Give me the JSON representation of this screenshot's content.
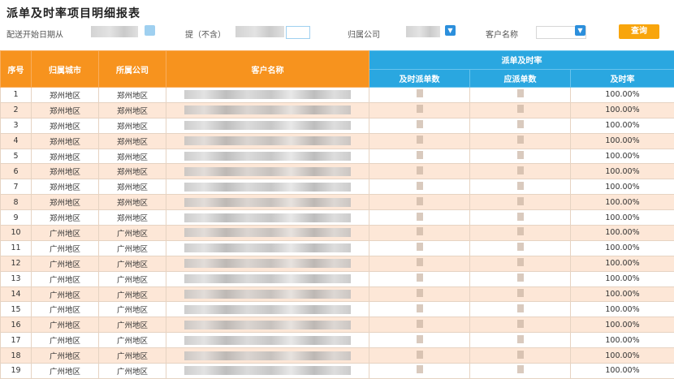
{
  "page": {
    "title": "派单及时率项目明细报表"
  },
  "filters": {
    "start_date_label": "配送开始日期从",
    "status_label": "提（不含）",
    "company_label": "归属公司",
    "customer_label": "客户名称",
    "dropdown_icon": "chevron-down-icon",
    "query_label": "查询"
  },
  "table": {
    "headers": {
      "seq": "序号",
      "region": "归属城市",
      "company": "所属公司",
      "customer": "客户名称",
      "group": "派单及时率",
      "col1": "及时派单数",
      "col2": "应派单数",
      "col3": "及时率"
    },
    "rows": [
      {
        "seq": "1",
        "region": "郑州地区",
        "company": "郑州地区",
        "rate": "100.00%"
      },
      {
        "seq": "2",
        "region": "郑州地区",
        "company": "郑州地区",
        "rate": "100.00%"
      },
      {
        "seq": "3",
        "region": "郑州地区",
        "company": "郑州地区",
        "rate": "100.00%"
      },
      {
        "seq": "4",
        "region": "郑州地区",
        "company": "郑州地区",
        "rate": "100.00%"
      },
      {
        "seq": "5",
        "region": "郑州地区",
        "company": "郑州地区",
        "rate": "100.00%"
      },
      {
        "seq": "6",
        "region": "郑州地区",
        "company": "郑州地区",
        "rate": "100.00%"
      },
      {
        "seq": "7",
        "region": "郑州地区",
        "company": "郑州地区",
        "rate": "100.00%"
      },
      {
        "seq": "8",
        "region": "郑州地区",
        "company": "郑州地区",
        "rate": "100.00%"
      },
      {
        "seq": "9",
        "region": "郑州地区",
        "company": "郑州地区",
        "rate": "100.00%"
      },
      {
        "seq": "10",
        "region": "广州地区",
        "company": "广州地区",
        "rate": "100.00%"
      },
      {
        "seq": "11",
        "region": "广州地区",
        "company": "广州地区",
        "rate": "100.00%"
      },
      {
        "seq": "12",
        "region": "广州地区",
        "company": "广州地区",
        "rate": "100.00%"
      },
      {
        "seq": "13",
        "region": "广州地区",
        "company": "广州地区",
        "rate": "100.00%"
      },
      {
        "seq": "14",
        "region": "广州地区",
        "company": "广州地区",
        "rate": "100.00%"
      },
      {
        "seq": "15",
        "region": "广州地区",
        "company": "广州地区",
        "rate": "100.00%"
      },
      {
        "seq": "16",
        "region": "广州地区",
        "company": "广州地区",
        "rate": "100.00%"
      },
      {
        "seq": "17",
        "region": "广州地区",
        "company": "广州地区",
        "rate": "100.00%"
      },
      {
        "seq": "18",
        "region": "广州地区",
        "company": "广州地区",
        "rate": "100.00%"
      },
      {
        "seq": "19",
        "region": "广州地区",
        "company": "广州地区",
        "rate": "100.00%"
      }
    ]
  },
  "colors": {
    "header_orange": "#f7931e",
    "header_blue": "#2aa7e0",
    "row_stripe": "#fde7d7",
    "query_button": "#f8a50c",
    "dropdown_button": "#2c8fdc"
  }
}
